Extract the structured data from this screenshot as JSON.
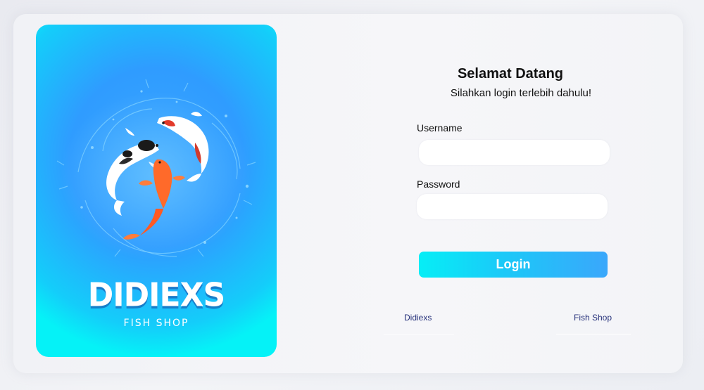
{
  "hero": {
    "brand_name": "DIDIEXS",
    "brand_sub": "FISH SHOP"
  },
  "form": {
    "title": "Selamat Datang",
    "subtitle": "Silahkan login terlebih dahulu!",
    "username_label": "Username",
    "username_value": "",
    "password_label": "Password",
    "password_value": "",
    "login_label": "Login"
  },
  "footer": {
    "left_link": "Didiexs",
    "right_link": "Fish Shop"
  },
  "colors": {
    "accent_start": "#06eef6",
    "accent_end": "#3aa7fb",
    "link": "#25307a"
  }
}
